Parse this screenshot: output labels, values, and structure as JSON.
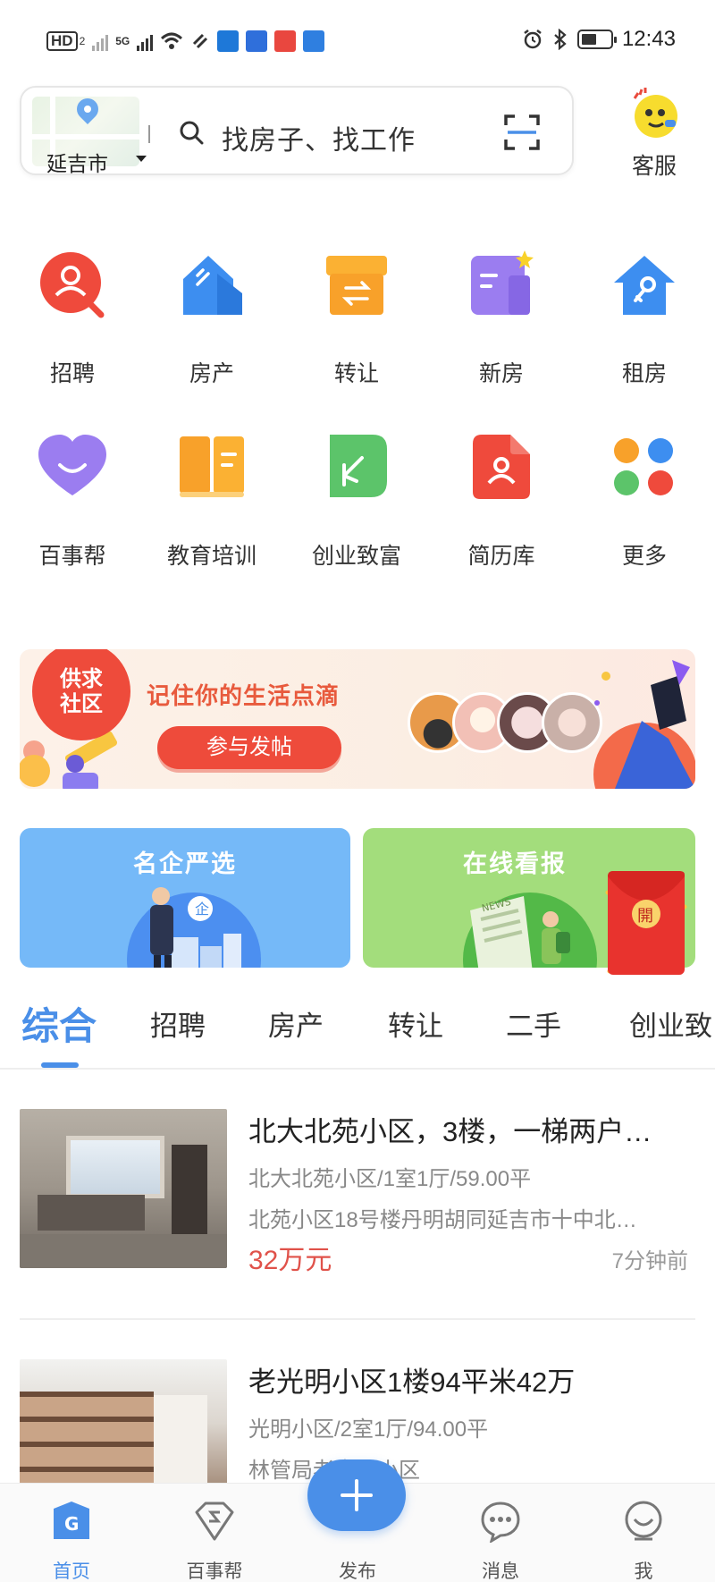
{
  "status_bar": {
    "network": "HD",
    "network_sub": "2",
    "signal2": "5G",
    "time": "12:43"
  },
  "header": {
    "city": "延吉市",
    "search_placeholder": "找房子、找工作",
    "service_label": "客服"
  },
  "categories": [
    {
      "label": "招聘",
      "icon": "recruit-icon",
      "color": "#ef4a3c"
    },
    {
      "label": "房产",
      "icon": "house-icon",
      "color": "#3d8ef0"
    },
    {
      "label": "转让",
      "icon": "transfer-box-icon",
      "color": "#f8a12a"
    },
    {
      "label": "新房",
      "icon": "new-house-icon",
      "color": "#9b7df0"
    },
    {
      "label": "租房",
      "icon": "rent-key-icon",
      "color": "#3d8ef0"
    },
    {
      "label": "百事帮",
      "icon": "heart-icon",
      "color": "#9b7df0"
    },
    {
      "label": "教育培训",
      "icon": "book-icon",
      "color": "#f8a12a"
    },
    {
      "label": "创业致富",
      "icon": "sprout-icon",
      "color": "#5cc46a"
    },
    {
      "label": "简历库",
      "icon": "resume-icon",
      "color": "#ef4a3c"
    },
    {
      "label": "更多",
      "icon": "more-dots-icon",
      "color": "#f8a12a"
    }
  ],
  "community_banner": {
    "badge_line1": "供求",
    "badge_line2": "社区",
    "title": "记住你的生活点滴",
    "button": "参与发帖"
  },
  "promos": {
    "left_title": "名企严选",
    "right_title": "在线看报",
    "envelope_char": "開"
  },
  "tabs": [
    "综合",
    "招聘",
    "房产",
    "转让",
    "二手",
    "创业致"
  ],
  "active_tab": 0,
  "listings": [
    {
      "title": "北大北苑小区，3楼，一梯两户…",
      "sub": "北大北苑小区/1室1厅/59.00平",
      "addr": "北苑小区18号楼丹明胡同延吉市十中北…",
      "price": "32万元",
      "time": "7分钟前"
    },
    {
      "title": "老光明小区1楼94平米42万",
      "sub": "光明小区/2室1厅/94.00平",
      "addr": "林管局老光明小区",
      "price": "",
      "time": ""
    }
  ],
  "bottom_nav": [
    {
      "label": "首页",
      "icon": "home-g-icon"
    },
    {
      "label": "百事帮",
      "icon": "diamond-s-icon"
    },
    {
      "label": "发布",
      "icon": "plus-icon"
    },
    {
      "label": "消息",
      "icon": "chat-bubble-icon"
    },
    {
      "label": "我",
      "icon": "profile-face-icon"
    }
  ],
  "colors": {
    "accent": "#4a8fe8",
    "price": "#e0524a",
    "banner_red": "#ee4b3b"
  }
}
